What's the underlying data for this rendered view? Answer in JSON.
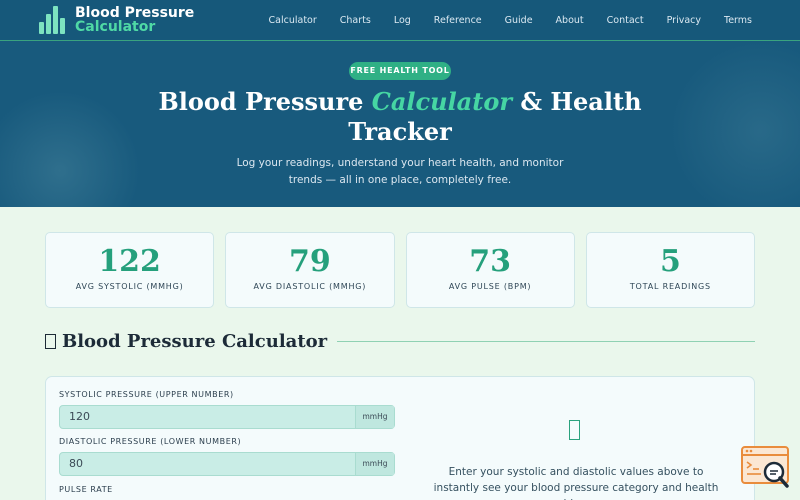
{
  "app": {
    "brand_line1": "Blood Pressure",
    "brand_line2": "Calculator"
  },
  "nav": {
    "links": [
      "Calculator",
      "Charts",
      "Log",
      "Reference",
      "Guide",
      "About",
      "Contact",
      "Privacy",
      "Terms"
    ]
  },
  "hero": {
    "pill": "FREE HEALTH TOOL",
    "title_part1": "Blood Pressure ",
    "title_accent": "Calculator",
    "title_part2": " & Health",
    "title_line2": "Tracker",
    "subtitle": "Log your readings, understand your heart health, and monitor trends — all in one place, completely free."
  },
  "stats": [
    {
      "value": "122",
      "label": "AVG SYSTOLIC (MMHG)"
    },
    {
      "value": "79",
      "label": "AVG DIASTOLIC (MMHG)"
    },
    {
      "value": "73",
      "label": "AVG PULSE (BPM)"
    },
    {
      "value": "5",
      "label": "TOTAL READINGS"
    }
  ],
  "calculator": {
    "section_title": "Blood Pressure Calculator",
    "systolic_label": "SYSTOLIC PRESSURE (UPPER NUMBER)",
    "systolic_value": "120",
    "systolic_unit": "mmHg",
    "diastolic_label": "DIASTOLIC PRESSURE (LOWER NUMBER)",
    "diastolic_value": "80",
    "diastolic_unit": "mmHg",
    "pulse_label": "PULSE RATE",
    "hint": "Enter your systolic and diastolic values above to instantly see your blood pressure category and health guidance."
  },
  "colors": {
    "nav_bg": "#16587a",
    "hero_bg": "#185a7d",
    "accent": "#2fb085",
    "page_bg": "#eaf7ec"
  },
  "icons": {
    "logo": "bar-chart-logo-icon",
    "section": "missing-glyph-icon",
    "result_placeholder": "missing-glyph-icon",
    "floating_badge": "code-search-icon"
  }
}
